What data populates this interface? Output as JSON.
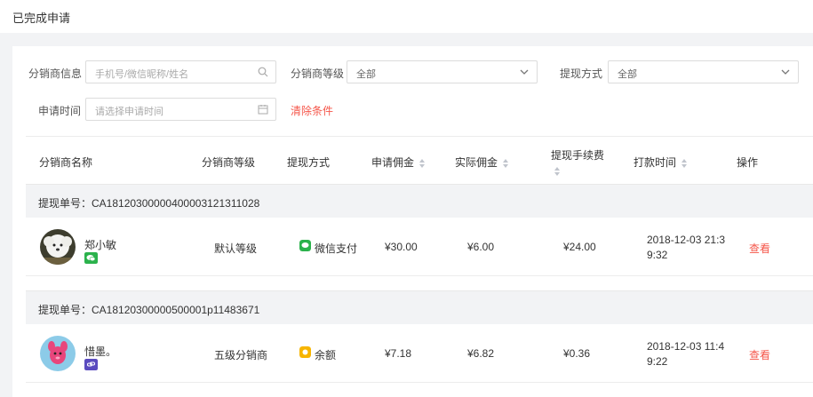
{
  "page": {
    "title": "已完成申请"
  },
  "filters": {
    "distributor_info_label": "分销商信息",
    "distributor_info_placeholder": "手机号/微信昵称/姓名",
    "level_label": "分销商等级",
    "level_value": "全部",
    "method_label": "提现方式",
    "method_value": "全部",
    "time_label": "申请时间",
    "time_placeholder": "请选择申请时间",
    "clear_label": "清除条件"
  },
  "table": {
    "headers": {
      "name": "分销商名称",
      "level": "分销商等级",
      "method": "提现方式",
      "apply_commission": "申请佣金",
      "actual_commission": "实际佣金",
      "fee": "提现手续费",
      "pay_time": "打款时间",
      "action": "操作"
    },
    "rows": [
      {
        "order_label": "提现单号：CA18120300000400003121311028",
        "name": "郑小敏",
        "level": "默认等级",
        "method": "微信支付",
        "method_icon": "wechat-pay-icon",
        "source_icon": "wechat-icon",
        "apply_commission": "¥30.00",
        "actual_commission": "¥6.00",
        "fee": "¥24.00",
        "pay_time_line1": "2018-12-03 21:3",
        "pay_time_line2": "9:32",
        "action": "查看"
      },
      {
        "order_label": "提现单号：CA18120300000500001p11483671",
        "name": "惜墨。",
        "level": "五级分销商",
        "method": "余额",
        "method_icon": "balance-icon",
        "source_icon": "link-icon",
        "apply_commission": "¥7.18",
        "actual_commission": "¥6.82",
        "fee": "¥0.36",
        "pay_time_line1": "2018-12-03 11:4",
        "pay_time_line2": "9:22",
        "action": "查看"
      }
    ]
  },
  "colors": {
    "accent": "#f5564a",
    "wechat": "#2bb24c",
    "balance": "#f7b500",
    "link": "#5a4bbf"
  }
}
